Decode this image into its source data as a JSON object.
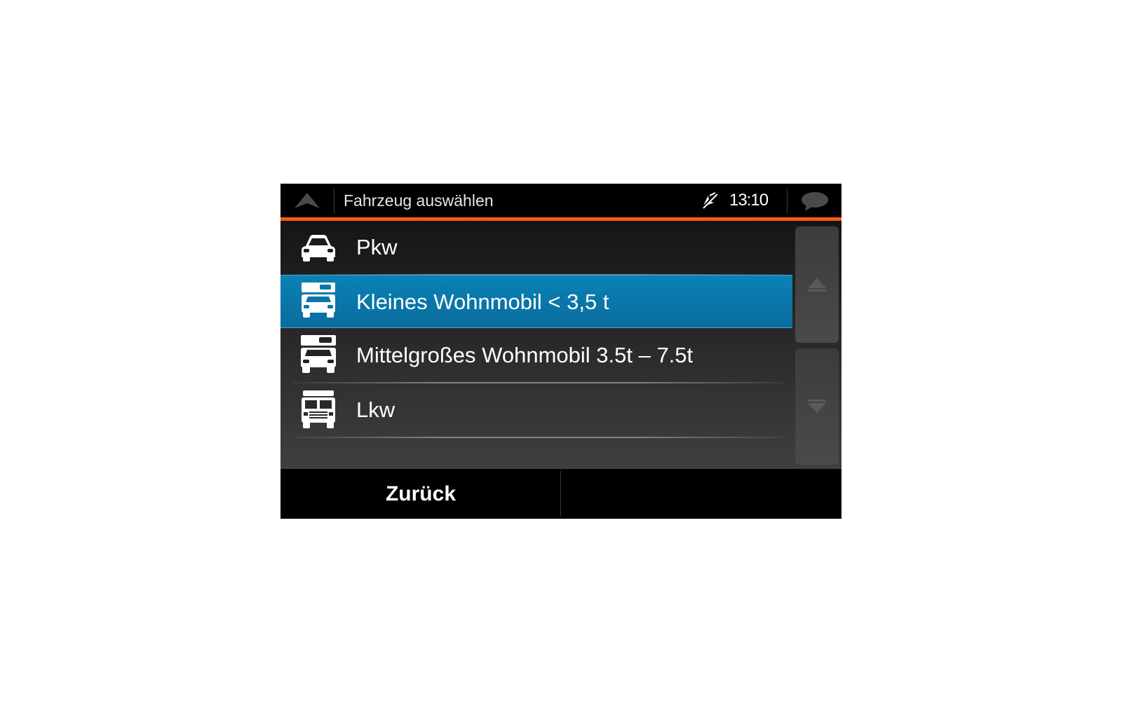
{
  "header": {
    "title": "Fahrzeug auswählen",
    "time": "13:10",
    "accent_color": "#ff5a14",
    "icons": [
      "nav-up-arrow-icon",
      "gps-off-icon",
      "message-bubble-icon"
    ]
  },
  "vehicles": {
    "items": [
      {
        "label": "Pkw",
        "icon": "car-icon",
        "selected": false
      },
      {
        "label": "Kleines Wohnmobil < 3,5 t",
        "icon": "small-camper-icon",
        "selected": true
      },
      {
        "label": "Mittelgroßes Wohnmobil 3.5t – 7.5t",
        "icon": "medium-camper-icon",
        "selected": false
      },
      {
        "label": "Lkw",
        "icon": "truck-icon",
        "selected": false
      }
    ],
    "selected_color": "#0a7fb2"
  },
  "scrollbar": {
    "up_icon": "scroll-up-icon",
    "down_icon": "scroll-down-icon"
  },
  "footer": {
    "back_label": "Zurück"
  }
}
